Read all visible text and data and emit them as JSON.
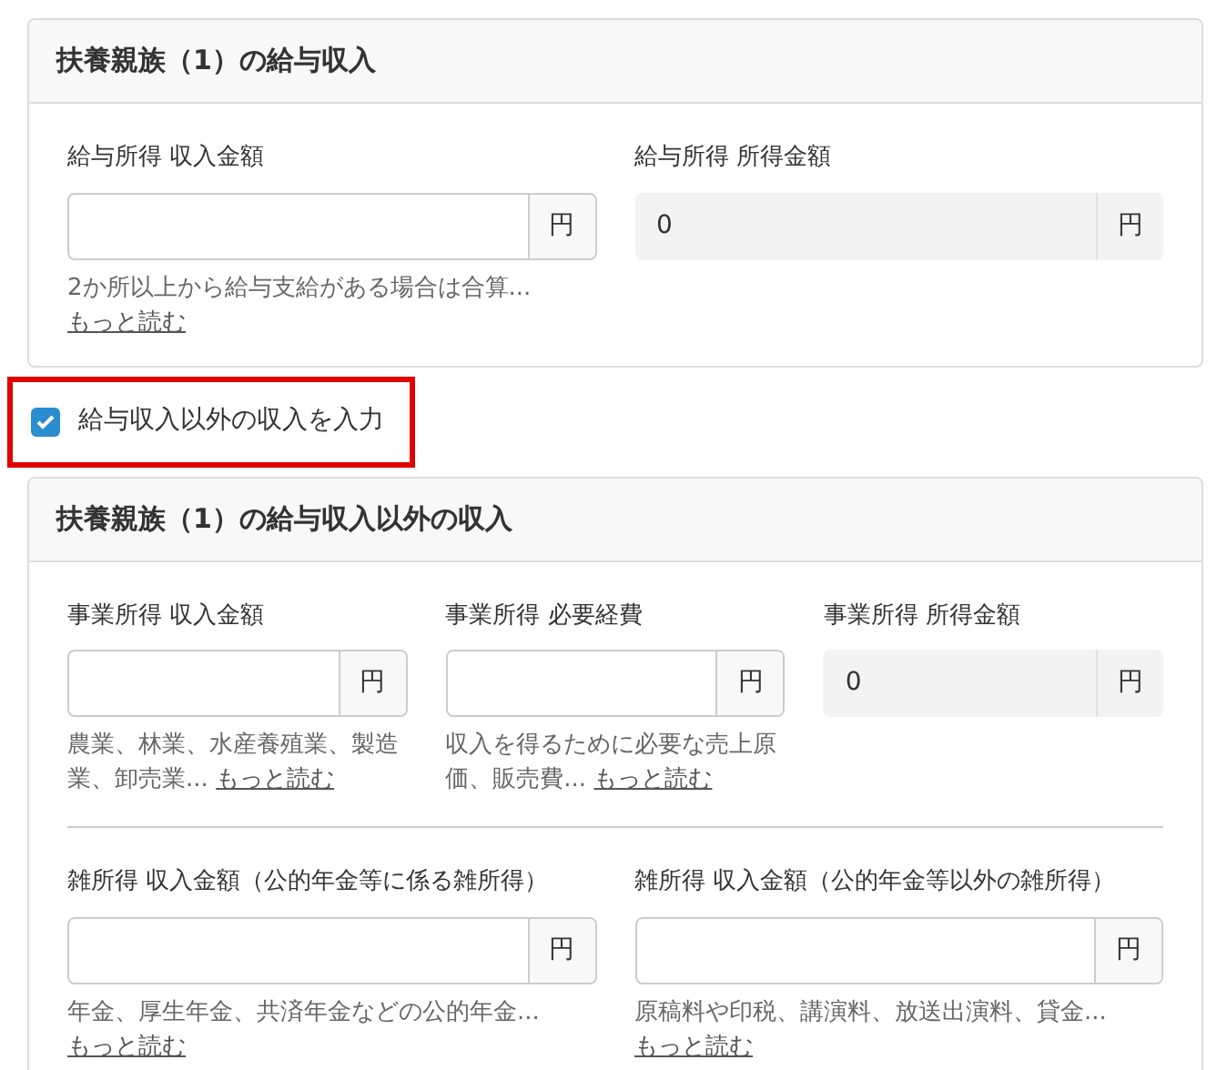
{
  "sections": [
    {
      "title": "扶養親族（1）の給与収入",
      "groups": [
        {
          "fields": [
            {
              "label": "給与所得 収入金額",
              "kind": "input",
              "unit": "円",
              "hint": "2か所以上から給与支給がある場合は合算...",
              "more": "もっと読む"
            },
            {
              "label": "給与所得 所得金額",
              "kind": "readonly",
              "value": "0",
              "unit": "円"
            }
          ]
        }
      ]
    },
    {
      "checkbox": {
        "label": "給与収入以外の収入を入力",
        "checked": true,
        "highlighted": true
      }
    },
    {
      "title": "扶養親族（1）の給与収入以外の収入",
      "groups": [
        {
          "fields": [
            {
              "label": "事業所得 収入金額",
              "kind": "input",
              "unit": "円",
              "hint": "農業、林業、水産養殖業、製造業、卸売業...",
              "more": "もっと読む"
            },
            {
              "label": "事業所得 必要経費",
              "kind": "input",
              "unit": "円",
              "hint": "収入を得るために必要な売上原価、販売費...",
              "more": "もっと読む"
            },
            {
              "label": "事業所得 所得金額",
              "kind": "readonly",
              "value": "0",
              "unit": "円"
            }
          ]
        },
        {
          "fields": [
            {
              "label": "雑所得 収入金額（公的年金等に係る雑所得）",
              "kind": "input",
              "unit": "円",
              "hint": "年金、厚生年金、共済年金などの公的年金...",
              "more": "もっと読む"
            },
            {
              "label": "雑所得 収入金額（公的年金等以外の雑所得）",
              "kind": "input",
              "unit": "円",
              "hint": "原稿料や印税、講演料、放送出演料、貸金...",
              "more": "もっと読む"
            }
          ]
        }
      ]
    }
  ]
}
